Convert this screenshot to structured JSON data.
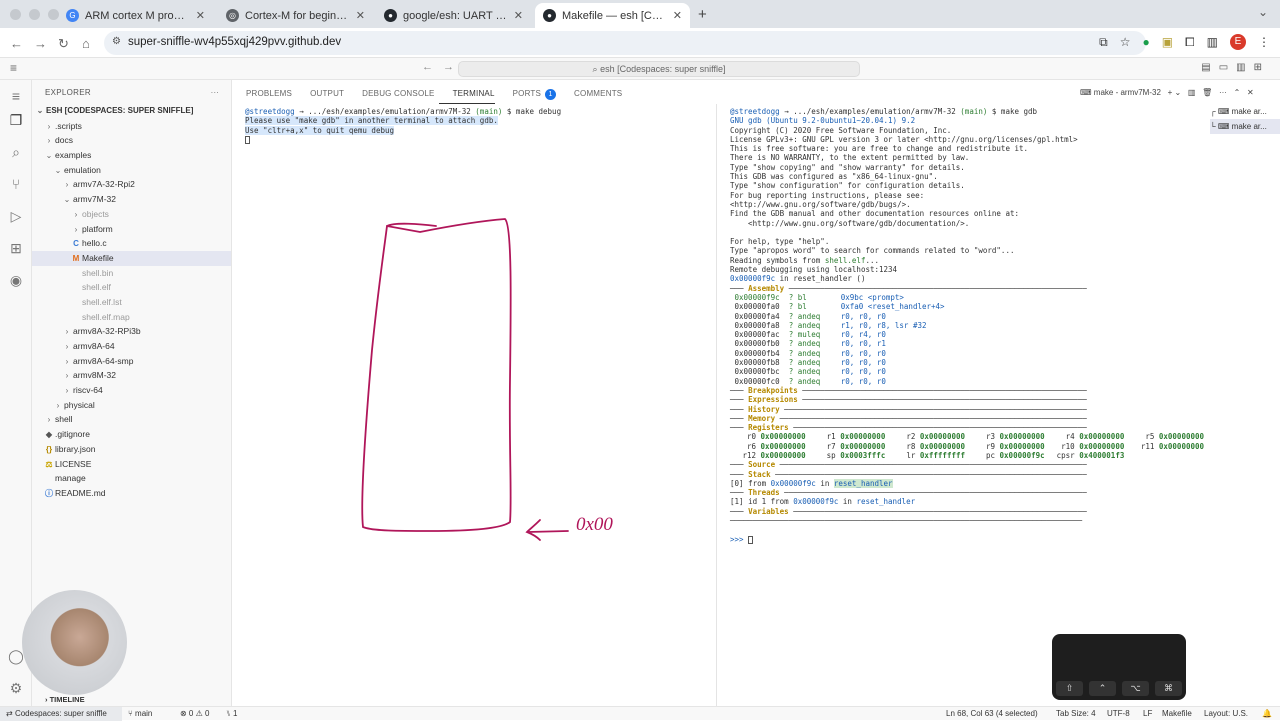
{
  "browser": {
    "tabs": [
      {
        "title": "ARM cortex M programmer's",
        "icon": "google-g-icon",
        "color": "#4285f4"
      },
      {
        "title": "Cortex-M for beginners",
        "icon": "globe-icon",
        "color": "#5f6368"
      },
      {
        "title": "google/esh: UART based em",
        "icon": "github-icon",
        "color": "#24292f"
      },
      {
        "title": "Makefile — esh [Codespaces",
        "icon": "github-icon",
        "color": "#24292f"
      }
    ],
    "url": "super-sniffle-wv4p55xqj429pvv.github.dev",
    "profile_initial": "E"
  },
  "vscode": {
    "command_center": "esh [Codespaces: super sniffle]",
    "explorer": {
      "header": "EXPLORER",
      "root": "ESH [CODESPACES: SUPER SNIFFLE]",
      "items": [
        {
          "label": ".scripts",
          "type": "folder-closed",
          "depth": 1
        },
        {
          "label": "docs",
          "type": "folder-closed",
          "depth": 1
        },
        {
          "label": "examples",
          "type": "folder-open",
          "depth": 1
        },
        {
          "label": "emulation",
          "type": "folder-open",
          "depth": 2
        },
        {
          "label": "armv7A-32-Rpi2",
          "type": "folder-closed",
          "depth": 3
        },
        {
          "label": "armv7M-32",
          "type": "folder-open",
          "depth": 3
        },
        {
          "label": "objects",
          "type": "folder-closed",
          "depth": 4,
          "dim": true
        },
        {
          "label": "platform",
          "type": "folder-closed",
          "depth": 4
        },
        {
          "label": "hello.c",
          "type": "c",
          "depth": 4
        },
        {
          "label": "Makefile",
          "type": "make",
          "depth": 4,
          "selected": true
        },
        {
          "label": "shell.bin",
          "type": "file",
          "depth": 4,
          "dim": true
        },
        {
          "label": "shell.elf",
          "type": "file",
          "depth": 4,
          "dim": true
        },
        {
          "label": "shell.elf.lst",
          "type": "file",
          "depth": 4,
          "dim": true
        },
        {
          "label": "shell.elf.map",
          "type": "file",
          "depth": 4,
          "dim": true
        },
        {
          "label": "armv8A-32-RPi3b",
          "type": "folder-closed",
          "depth": 3
        },
        {
          "label": "armv8A-64",
          "type": "folder-closed",
          "depth": 3
        },
        {
          "label": "armv8A-64-smp",
          "type": "folder-closed",
          "depth": 3
        },
        {
          "label": "armv8M-32",
          "type": "folder-closed",
          "depth": 3
        },
        {
          "label": "riscv-64",
          "type": "folder-closed",
          "depth": 3
        },
        {
          "label": "physical",
          "type": "folder-closed",
          "depth": 2
        },
        {
          "label": "shell",
          "type": "folder-closed",
          "depth": 1
        },
        {
          "label": ".gitignore",
          "type": "git",
          "depth": 1
        },
        {
          "label": "library.json",
          "type": "json",
          "depth": 1
        },
        {
          "label": "LICENSE",
          "type": "license",
          "depth": 1
        },
        {
          "label": "manage",
          "type": "file",
          "depth": 1
        },
        {
          "label": "README.md",
          "type": "md",
          "depth": 1
        }
      ],
      "timeline": "TIMELINE"
    },
    "panel_tabs": [
      {
        "label": "PROBLEMS"
      },
      {
        "label": "OUTPUT"
      },
      {
        "label": "DEBUG CONSOLE"
      },
      {
        "label": "TERMINAL",
        "active": true
      },
      {
        "label": "PORTS",
        "badge": "1"
      },
      {
        "label": "COMMENTS"
      }
    ],
    "terminal_toolbar": "make - armv7M-32",
    "terminal_list": [
      "make ar...",
      "make ar..."
    ],
    "term1": {
      "prompt_user": "@streetdogg",
      "prompt_path": "→ .../esh/examples/emulation/armv7M-32",
      "prompt_branch": "(main)",
      "command": "$ make debug",
      "lines": [
        "Please use \"make gdb\" in another terminal to attach gdb.",
        "Use \"cltr+a,x\" to quit qemu debug"
      ]
    },
    "term2": {
      "prompt_user": "@streetdogg",
      "prompt_path": "→ .../esh/examples/emulation/armv7M-32",
      "prompt_branch": "(main)",
      "command": "$ make gdb",
      "gdb_banner": "GNU gdb (Ubuntu 9.2-0ubuntu1~20.04.1) 9.2",
      "intro_lines": [
        "Copyright (C) 2020 Free Software Foundation, Inc.",
        "License GPLv3+: GNU GPL version 3 or later <http://gnu.org/licenses/gpl.html>",
        "This is free software: you are free to change and redistribute it.",
        "There is NO WARRANTY, to the extent permitted by law.",
        "Type \"show copying\" and \"show warranty\" for details.",
        "This GDB was configured as \"x86_64-linux-gnu\".",
        "Type \"show configuration\" for configuration details.",
        "For bug reporting instructions, please see:",
        "<http://www.gnu.org/software/gdb/bugs/>.",
        "Find the GDB manual and other documentation resources online at:",
        "    <http://www.gnu.org/software/gdb/documentation/>.",
        "",
        "For help, type \"help\".",
        "Type \"apropos word\" to search for commands related to \"word\"..."
      ],
      "reading_prefix": "Reading symbols from ",
      "reading_file": "shell.elf",
      "reading_suffix": "...",
      "remote": "Remote debugging using localhost:1234",
      "frame_addr": "0x00000f9c",
      "frame_text": " in reset_handler ()",
      "assembly": [
        {
          "addr": "0x00000f9c",
          "mn": "? bl",
          "op": "0x9bc <prompt>",
          "cur": true
        },
        {
          "addr": "0x00000fa0",
          "mn": "? bl",
          "op": "0xfa0 <reset_handler+4>"
        },
        {
          "addr": "0x00000fa4",
          "mn": "? andeq",
          "op": "r0, r0, r0"
        },
        {
          "addr": "0x00000fa8",
          "mn": "? andeq",
          "op": "r1, r0, r8, lsr #32"
        },
        {
          "addr": "0x00000fac",
          "mn": "? muleq",
          "op": "r0, r4, r0"
        },
        {
          "addr": "0x00000fb0",
          "mn": "? andeq",
          "op": "r0, r0, r1"
        },
        {
          "addr": "0x00000fb4",
          "mn": "? andeq",
          "op": "r0, r0, r0"
        },
        {
          "addr": "0x00000fb8",
          "mn": "? andeq",
          "op": "r0, r0, r0"
        },
        {
          "addr": "0x00000fbc",
          "mn": "? andeq",
          "op": "r0, r0, r0"
        },
        {
          "addr": "0x00000fc0",
          "mn": "? andeq",
          "op": "r0, r0, r0"
        }
      ],
      "sections": {
        "assembly": "Assembly",
        "breakpoints": "Breakpoints",
        "expressions": "Expressions",
        "history": "History",
        "memory": "Memory",
        "registers": "Registers",
        "source": "Source",
        "stack": "Stack",
        "threads": "Threads",
        "variables": "Variables"
      },
      "registers": [
        [
          [
            "r0",
            "0x00000000"
          ],
          [
            "r1",
            "0x00000000"
          ],
          [
            "r2",
            "0x00000000"
          ],
          [
            "r3",
            "0x00000000"
          ],
          [
            "r4",
            "0x00000000"
          ],
          [
            "r5",
            "0x00000000"
          ]
        ],
        [
          [
            "r6",
            "0x00000000"
          ],
          [
            "r7",
            "0x00000000"
          ],
          [
            "r8",
            "0x00000000"
          ],
          [
            "r9",
            "0x00000000"
          ],
          [
            "r10",
            "0x00000000"
          ],
          [
            "r11",
            "0x00000000"
          ]
        ],
        [
          [
            "r12",
            "0x00000000"
          ],
          [
            "sp",
            "0x0003fffc"
          ],
          [
            "lr",
            "0xffffffff"
          ],
          [
            "pc",
            "0x00000f9c"
          ],
          [
            "cpsr",
            "0x400001f3"
          ]
        ]
      ],
      "stack_line": {
        "idx": "[0]",
        "from": "from",
        "addr": "0x00000f9c",
        "in": "in",
        "fn": "reset_handler"
      },
      "threads_line": {
        "idx": "[1]",
        "text": "id 1 from",
        "addr": "0x00000f9c",
        "in": "in",
        "fn": "reset_handler"
      },
      "prompt": ">>>"
    },
    "annotation_text": "0x00",
    "status": {
      "remote": "Codespaces: super sniffle",
      "branch": "main",
      "problems": "⊗ 0 ⚠ 0",
      "ports": "1",
      "position": "Ln 68, Col 63 (4 selected)",
      "tab_size": "Tab Size: 4",
      "encoding": "UTF-8",
      "eol": "LF",
      "language": "Makefile",
      "layout": "Layout: U.S."
    },
    "keyboard_keys": [
      "⇧",
      "⌃",
      "⌥",
      "⌘"
    ]
  }
}
